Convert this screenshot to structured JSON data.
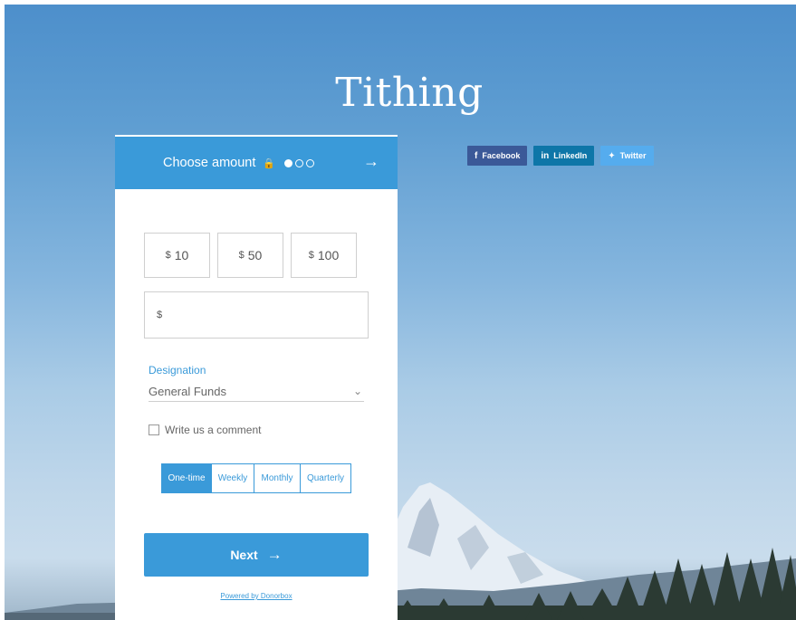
{
  "page": {
    "title": "Tithing"
  },
  "social": [
    {
      "label": "Facebook",
      "icon": "f"
    },
    {
      "label": "LinkedIn",
      "icon": "in"
    },
    {
      "label": "Twitter",
      "icon": "✦"
    }
  ],
  "form": {
    "header": {
      "title": "Choose amount",
      "lock_icon": "lock-icon",
      "steps_total": 3,
      "step_current": 1
    },
    "amounts": [
      {
        "currency": "$",
        "value": "10"
      },
      {
        "currency": "$",
        "value": "50"
      },
      {
        "currency": "$",
        "value": "100"
      }
    ],
    "custom_amount": {
      "currency": "$",
      "value": "",
      "placeholder": ""
    },
    "designation": {
      "label": "Designation",
      "selected": "General Funds"
    },
    "comment": {
      "label": "Write us a comment",
      "checked": false
    },
    "frequency": {
      "options": [
        "One-time",
        "Weekly",
        "Monthly",
        "Quarterly"
      ],
      "selected": "One-time"
    },
    "next_button": {
      "label": "Next"
    },
    "powered_by": "Powered by Donorbox"
  },
  "colors": {
    "accent": "#3a9ad9",
    "facebook": "#3b5998",
    "linkedin": "#0e76a8",
    "twitter": "#55acee"
  }
}
